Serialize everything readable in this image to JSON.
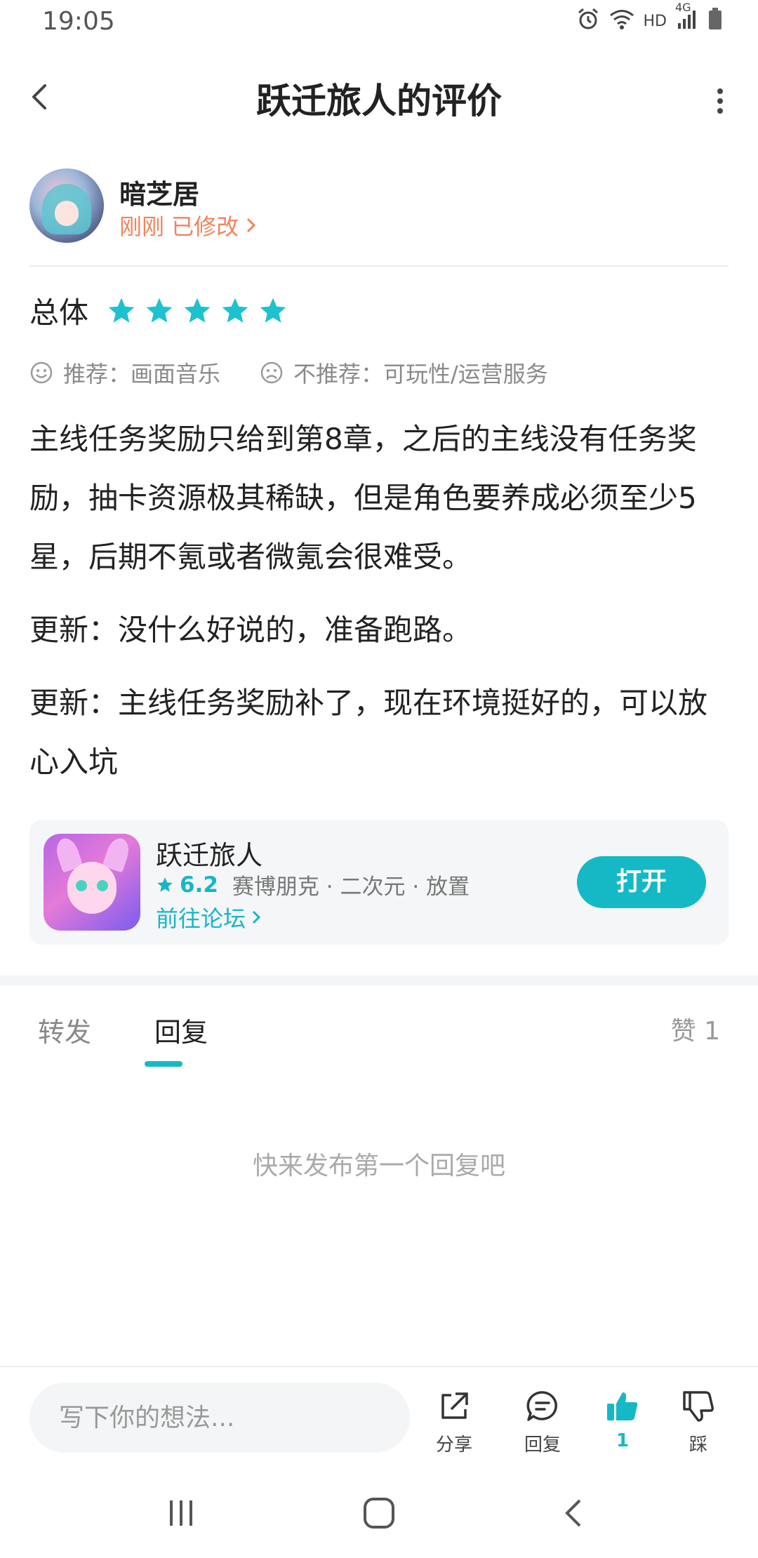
{
  "status_bar": {
    "time": "19:05",
    "network": "HD",
    "signal": "4G",
    "icons": [
      "alarm-icon",
      "wifi-icon",
      "signal-icon",
      "battery-icon"
    ]
  },
  "nav": {
    "title": "跃迁旅人的评价",
    "back_icon": "chevron-left-icon",
    "more_icon": "more-vertical-icon"
  },
  "author": {
    "name": "暗芝居",
    "meta": "刚刚 已修改",
    "meta_color": "#f0845c"
  },
  "rating": {
    "label": "总体",
    "stars": 5,
    "max": 5,
    "star_color": "#1ec2cf"
  },
  "tags": {
    "recommend": "推荐：画面音乐",
    "not_recommend": "不推荐：可玩性/运营服务"
  },
  "review": {
    "paragraphs": [
      "主线任务奖励只给到第8章，之后的主线没有任务奖励，抽卡资源极其稀缺，但是角色要养成必须至少5星，后期不氪或者微氪会很难受。",
      "更新：没什么好说的，准备跑路。",
      "更新：主线任务奖励补了，现在环境挺好的，可以放心入坑"
    ]
  },
  "app_card": {
    "name": "跃迁旅人",
    "score": "6.2",
    "tags": "赛博朋克 · 二次元 · 放置",
    "forum_link": "前往论坛",
    "open_label": "打开",
    "accent": "#15b9c6"
  },
  "tabs": {
    "forward": "转发",
    "reply": "回复",
    "likes": "赞 1",
    "active": "reply"
  },
  "empty_hint": "快来发布第一个回复吧",
  "toolbar": {
    "input_placeholder": "写下你的想法...",
    "share_label": "分享",
    "reply_label": "回复",
    "like_count": "1",
    "dislike_label": "踩"
  },
  "system_nav": {
    "icons": [
      "recent-apps-icon",
      "home-icon",
      "back-icon"
    ]
  }
}
